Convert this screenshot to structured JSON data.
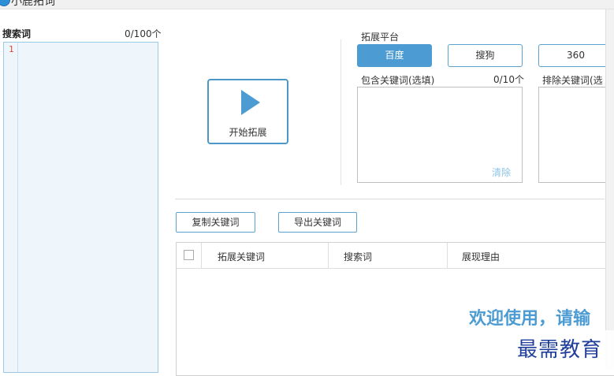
{
  "window": {
    "title": "小鹿拓词"
  },
  "search": {
    "label": "搜索词",
    "count": "0/100个",
    "line_number": "1"
  },
  "start_button": {
    "label": "开始拓展"
  },
  "platform": {
    "label": "拓展平台",
    "options": [
      {
        "label": "百度",
        "active": true
      },
      {
        "label": "搜狗",
        "active": false
      },
      {
        "label": "360",
        "active": false
      }
    ]
  },
  "include": {
    "label": "包含关键词(选填)",
    "count": "0/10个",
    "clear_label": "清除"
  },
  "exclude": {
    "label": "排除关键词(选"
  },
  "actions": {
    "copy_label": "复制关键词",
    "export_label": "导出关键词"
  },
  "table": {
    "columns": [
      "拓展关键词",
      "搜索词",
      "展现理由"
    ]
  },
  "welcome_text": "欢迎使用，请输",
  "watermark": "最需教育",
  "colors": {
    "accent": "#4c9cd3",
    "border_accent": "#5aa2cf",
    "editor_bg": "#eef6fc"
  }
}
